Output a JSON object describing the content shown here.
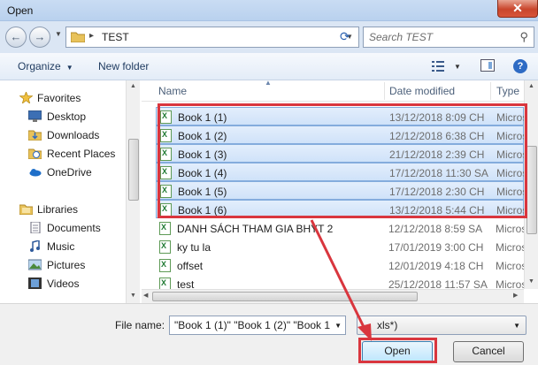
{
  "window": {
    "title": "Open",
    "close_label": "✕"
  },
  "navigation": {
    "back_glyph": "←",
    "forward_glyph": "→",
    "address_path": "TEST",
    "address_sep": "▸",
    "search_placeholder": "Search TEST"
  },
  "toolbar": {
    "organize_label": "Organize",
    "new_folder_label": "New folder",
    "help_label": "?"
  },
  "sidebar": {
    "favorites": {
      "label": "Favorites",
      "items": [
        {
          "label": "Desktop",
          "icon": "desktop-icon"
        },
        {
          "label": "Downloads",
          "icon": "downloads-icon"
        },
        {
          "label": "Recent Places",
          "icon": "recent-places-icon"
        },
        {
          "label": "OneDrive",
          "icon": "onedrive-icon"
        }
      ]
    },
    "libraries": {
      "label": "Libraries",
      "items": [
        {
          "label": "Documents",
          "icon": "documents-icon"
        },
        {
          "label": "Music",
          "icon": "music-icon"
        },
        {
          "label": "Pictures",
          "icon": "pictures-icon"
        },
        {
          "label": "Videos",
          "icon": "videos-icon"
        }
      ]
    }
  },
  "columns": {
    "name": "Name",
    "date": "Date modified",
    "type": "Type"
  },
  "files": [
    {
      "name": "Book 1 (1)",
      "date": "13/12/2018 8:09 CH",
      "type": "Micros",
      "selected": true
    },
    {
      "name": "Book 1 (2)",
      "date": "12/12/2018 6:38 CH",
      "type": "Micros",
      "selected": true
    },
    {
      "name": "Book 1 (3)",
      "date": "21/12/2018 2:39 CH",
      "type": "Micros",
      "selected": true
    },
    {
      "name": "Book 1 (4)",
      "date": "17/12/2018 11:30 SA",
      "type": "Micros",
      "selected": true
    },
    {
      "name": "Book 1 (5)",
      "date": "17/12/2018 2:30 CH",
      "type": "Micros",
      "selected": true
    },
    {
      "name": "Book 1 (6)",
      "date": "13/12/2018 5:44 CH",
      "type": "Micros",
      "selected": true
    },
    {
      "name": "DANH SÁCH THAM GIA BHYT 2",
      "date": "12/12/2018 8:59 SA",
      "type": "Micros",
      "selected": false
    },
    {
      "name": "ky tu la",
      "date": "17/01/2019 3:00 CH",
      "type": "Micros",
      "selected": false
    },
    {
      "name": "offset",
      "date": "12/01/2019 4:18 CH",
      "type": "Micros",
      "selected": false
    },
    {
      "name": "test",
      "date": "25/12/2018 11:57 SA",
      "type": "Micros",
      "selected": false
    }
  ],
  "footer": {
    "file_name_label": "File name:",
    "file_name_value": "\"Book 1 (1)\" \"Book 1 (2)\" \"Book 1 (",
    "file_type_value": "xls*)",
    "open_label": "Open",
    "cancel_label": "Cancel"
  },
  "colors": {
    "highlight": "#d9363e",
    "selection": "#cfe2f9",
    "accent": "#2e6bc4"
  }
}
